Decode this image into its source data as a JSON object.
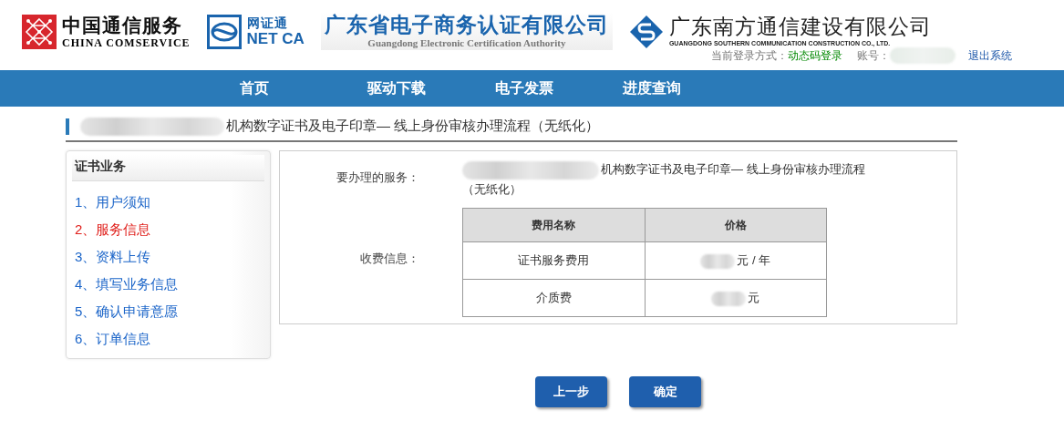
{
  "header": {
    "logos": [
      {
        "kind": "comservice",
        "name": "中国通信服务",
        "subtitle": "CHINA COMSERVICE"
      },
      {
        "kind": "netca",
        "name": "网证通",
        "subtitle": "NET CA"
      },
      {
        "kind": "plain",
        "name": "广东省电子商务认证有限公司",
        "subtitle": "Guangdong Electronic Certification Authority"
      },
      {
        "kind": "southern",
        "name": "广东南方通信建设有限公司",
        "subtitle": "GUANGDONG SOUTHERN COMMUNICATION CONSTRUCTION CO., LTD."
      }
    ],
    "login_method_label": "当前登录方式：",
    "login_method": "动态码登录",
    "account_label": "账号：",
    "logout": "退出系统"
  },
  "nav": [
    {
      "label": "首页"
    },
    {
      "label": "驱动下载"
    },
    {
      "label": "电子发票"
    },
    {
      "label": "进度查询"
    }
  ],
  "page_title": "机构数字证书及电子印章— 线上身份审核办理流程（无纸化）",
  "sidebar": {
    "title": "证书业务",
    "items": [
      {
        "label": "1、用户须知",
        "selected": false
      },
      {
        "label": "2、服务信息",
        "selected": true
      },
      {
        "label": "3、资料上传",
        "selected": false
      },
      {
        "label": "4、填写业务信息",
        "selected": false
      },
      {
        "label": "5、确认申请意愿",
        "selected": false
      },
      {
        "label": "6、订单信息",
        "selected": false
      }
    ]
  },
  "service": {
    "label": "要办理的服务：",
    "value": "机构数字证书及电子印章— 线上身份审核办理流程（无纸化）",
    "fee_label": "收费信息：",
    "fee_table": {
      "columns": [
        "费用名称",
        "价格"
      ],
      "rows": [
        [
          "证书服务费用",
          "元 / 年"
        ],
        [
          "介质费",
          "元"
        ]
      ]
    }
  },
  "buttons": [
    {
      "label": "上一步"
    },
    {
      "label": "确定"
    }
  ]
}
